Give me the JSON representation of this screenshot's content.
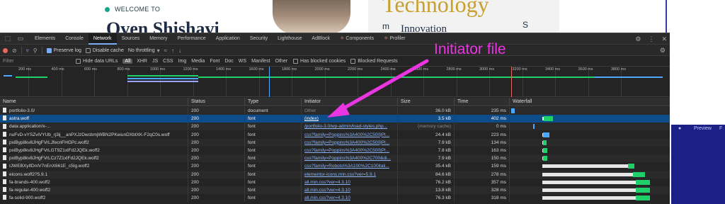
{
  "colors": {
    "annotation": "#ea36e2",
    "selected_row": "#0f4c8a",
    "timeline_green": "#1fcf6a",
    "timeline_blue": "#4aa8ff",
    "timeline_red": "#e46962",
    "welcome_dot": "#17a589"
  },
  "background_page": {
    "welcome": "WELCOME TO",
    "hero_fragment": "Oven Shishavi",
    "book_title": "Technology",
    "book_subtitle": "Innovation",
    "book_vertical_left": "m",
    "book_vertical_right": "S",
    "preview_label": "Preview",
    "apple_icon": "apple-logo-icon",
    "preview_trailing": "F"
  },
  "annotation": {
    "label": "Initiator file"
  },
  "devtools": {
    "tabs": [
      "Elements",
      "Console",
      "Network",
      "Sources",
      "Memory",
      "Performance",
      "Application",
      "Security",
      "Lighthouse",
      "AdBlock",
      "Components",
      "Profiler"
    ],
    "active_tab": "Network",
    "toolbar": {
      "preserve_log": "Preserve log",
      "preserve_log_checked": true,
      "disable_cache": "Disable cache",
      "disable_cache_checked": false,
      "throttling": "No throttling"
    },
    "filter": {
      "placeholder": "Filter",
      "hide_data_urls": "Hide data URLs",
      "types": [
        "All",
        "XHR",
        "JS",
        "CSS",
        "Img",
        "Media",
        "Font",
        "Doc",
        "WS",
        "Manifest",
        "Other"
      ],
      "selected_type": "All",
      "has_blocked_cookies": "Has blocked cookies",
      "blocked_requests": "Blocked Requests"
    },
    "overview": {
      "ticks": [
        "200 ms",
        "400 ms",
        "600 ms",
        "800 ms",
        "1000 ms",
        "1200 ms",
        "1400 ms",
        "1600 ms",
        "1800 ms",
        "2000 ms",
        "2200 ms",
        "2400 ms",
        "2600 ms",
        "2800 ms",
        "3000 ms",
        "3200 ms",
        "3400 ms",
        "3600 ms",
        "3800 ms"
      ]
    },
    "columns": {
      "name": "Name",
      "status": "Status",
      "type": "Type",
      "initiator": "Initiator",
      "size": "Size",
      "time": "Time",
      "waterfall": "Waterfall"
    },
    "rows": [
      {
        "name": "portfolio-3.0/",
        "status": "200",
        "type": "document",
        "initiator": "Other",
        "initiator_link": false,
        "size": "36.0 kB",
        "time": "235 ms",
        "selected": false,
        "wf_start": 0,
        "wf_wait": 0,
        "wf_recv": 0.022,
        "wf_color": "#4aa8ff"
      },
      {
        "name": "astra.woff",
        "status": "200",
        "type": "font",
        "initiator": "(index)",
        "initiator_link": true,
        "size": "3.5 kB",
        "time": "402 ms",
        "selected": true,
        "wf_start": 0.2,
        "wf_wait": 0.008,
        "wf_recv": 0.06,
        "wf_color": "#1fcf6a"
      },
      {
        "name": "data:application/x-...",
        "status": "200",
        "type": "font",
        "initiator": "/portfolio-3.0/wp-admin/load-styles.php...",
        "initiator_link": true,
        "size": "(memory cache)",
        "time": "0 ms",
        "selected": false,
        "wf_start": 0.14,
        "wf_wait": 0,
        "wf_recv": 0.004,
        "wf_color": "#4aa8ff"
      },
      {
        "name": "nuFvD-vYSZviVYUb_rj3ij__anPXJzDwcbmjWBN2PKeiunDXbtXK-F2qC0s.woff",
        "status": "200",
        "type": "font",
        "initiator": "css?family=Poppins%3A400%2C500|Pl...",
        "initiator_link": true,
        "size": "24.4 kB",
        "time": "223 ms",
        "selected": false,
        "wf_start": 0.2,
        "wf_wait": 0.006,
        "wf_recv": 0.04,
        "wf_color": "#4aa8ff"
      },
      {
        "name": "pxiByp8kv8JHgFVrLJfecnFHGPc.woff2",
        "status": "200",
        "type": "font",
        "initiator": "css?family=Poppins%3A400%2C500|Pl...",
        "initiator_link": true,
        "size": "7.9 kB",
        "time": "134 ms",
        "selected": false,
        "wf_start": 0.2,
        "wf_wait": 0.004,
        "wf_recv": 0.025,
        "wf_color": "#1fcf6a"
      },
      {
        "name": "pxiByp8kv8JHgFVrLGT9Z1xlFd2JQEk.woff2",
        "status": "200",
        "type": "font",
        "initiator": "css?family=Poppins%3A400%2C500|Pl...",
        "initiator_link": true,
        "size": "7.8 kB",
        "time": "163 ms",
        "selected": false,
        "wf_start": 0.2,
        "wf_wait": 0.004,
        "wf_recv": 0.03,
        "wf_color": "#1fcf6a"
      },
      {
        "name": "pxiByp8kv8JHgFVrLCz7Z1xlFd2JQEk.woff2",
        "status": "200",
        "type": "font",
        "initiator": "css?family=Poppins%3A400%2C700&di...",
        "initiator_link": true,
        "size": "7.9 kB",
        "time": "150 ms",
        "selected": false,
        "wf_start": 0.2,
        "wf_wait": 0.004,
        "wf_recv": 0.028,
        "wf_color": "#1fcf6a"
      },
      {
        "name": "IJWEBXyIfDnIV7nEnX661E_c5Ig.woff2",
        "status": "200",
        "type": "font",
        "initiator": "css?family=Roboto%3A100%2C100itali...",
        "initiator_link": true,
        "size": "35.4 kB",
        "time": "159 ms",
        "selected": false,
        "wf_start": 0.2,
        "wf_wait": 0.55,
        "wf_recv": 0.04,
        "wf_color": "#1fcf6a"
      },
      {
        "name": "eicons.woff2?5.9.1",
        "status": "200",
        "type": "font",
        "initiator": "elementor-icons.min.css?ver=5.9.1",
        "initiator_link": true,
        "size": "84.6 kB",
        "time": "278 ms",
        "selected": false,
        "wf_start": 0.2,
        "wf_wait": 0.58,
        "wf_recv": 0.08,
        "wf_color": "#1fcf6a"
      },
      {
        "name": "fa-brands-400.woff2",
        "status": "200",
        "type": "font",
        "initiator": "all.min.css?ver=4.3.10",
        "initiator_link": true,
        "size": "76.2 kB",
        "time": "357 ms",
        "selected": false,
        "wf_start": 0.2,
        "wf_wait": 0.6,
        "wf_recv": 0.09,
        "wf_color": "#1fcf6a"
      },
      {
        "name": "fa-regular-400.woff2",
        "status": "200",
        "type": "font",
        "initiator": "all.min.css?ver=4.3.10",
        "initiator_link": true,
        "size": "13.8 kB",
        "time": "328 ms",
        "selected": false,
        "wf_start": 0.2,
        "wf_wait": 0.6,
        "wf_recv": 0.09,
        "wf_color": "#1fcf6a"
      },
      {
        "name": "fa-solid-900.woff2",
        "status": "200",
        "type": "font",
        "initiator": "all.min.css?ver=4.3.10",
        "initiator_link": true,
        "size": "76.3 kB",
        "time": "318 ms",
        "selected": false,
        "wf_start": 0.2,
        "wf_wait": 0.6,
        "wf_recv": 0.09,
        "wf_color": "#1fcf6a"
      }
    ]
  }
}
